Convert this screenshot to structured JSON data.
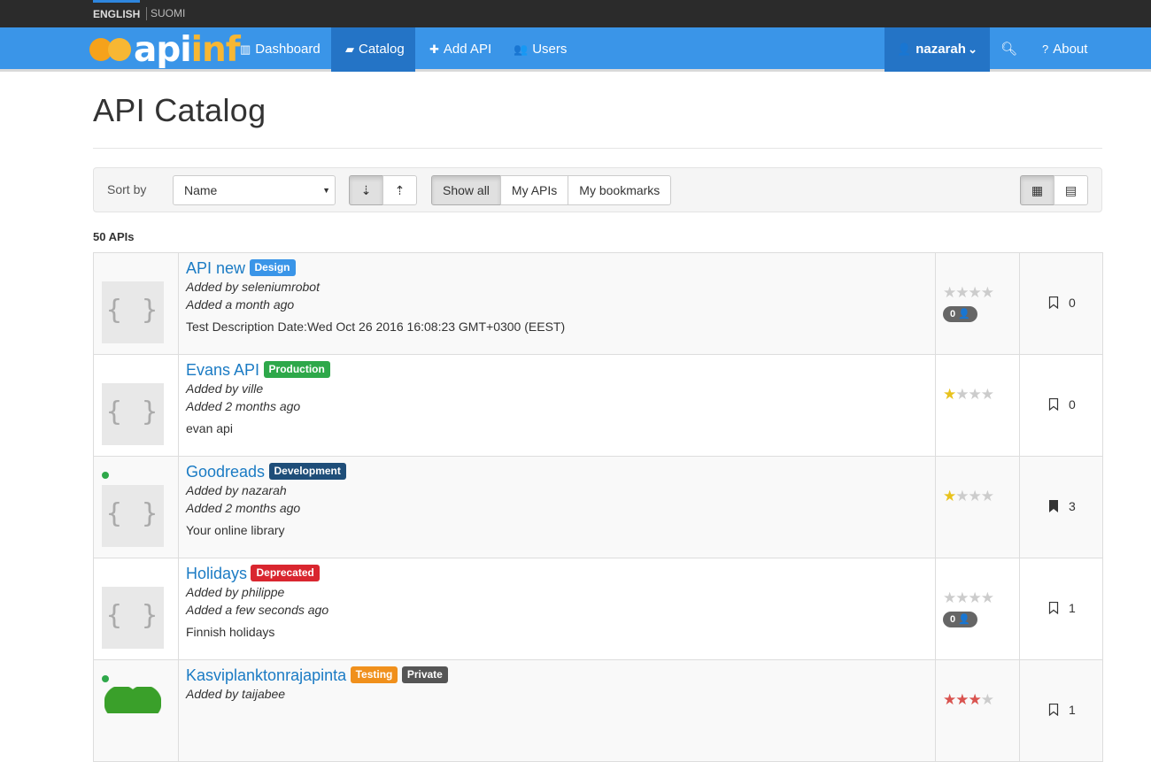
{
  "languages": [
    {
      "label": "ENGLISH"
    },
    {
      "label": "SUOMI"
    }
  ],
  "brand": {
    "api": "api",
    "inf": "inf"
  },
  "nav": {
    "dashboard": "Dashboard",
    "catalog": "Catalog",
    "add_api": "Add API",
    "users": "Users",
    "user": "nazarah",
    "about": "About"
  },
  "page": {
    "title": "API Catalog",
    "count": "50 APIs"
  },
  "filters": {
    "sort_label": "Sort by",
    "sort_value": "Name",
    "show_all": "Show all",
    "my_apis": "My APIs",
    "my_bookmarks": "My bookmarks"
  },
  "colors": {
    "development": "#1f4e79",
    "testing": "#f0901c",
    "production": "#2ea84a",
    "design": "#3a95e8",
    "deprecated": "#d9262f",
    "private": "#555555"
  },
  "apis": [
    {
      "name": "API new",
      "badge": "Design",
      "added_by": "Added by seleniumrobot",
      "added_when": "Added a month ago",
      "description": "Test Description Date:Wed Oct 26 2016 16:08:23 GMT+0300 (EEST)",
      "rating": 0,
      "user_ratings": "0",
      "bookmarks": "0"
    },
    {
      "name": "Evans API",
      "badge": "Production",
      "added_by": "Added by ville",
      "added_when": "Added 2 months ago",
      "description": "evan api",
      "rating": 1,
      "bookmarks": "0"
    },
    {
      "name": "Goodreads",
      "badge": "Development",
      "added_by": "Added by nazarah",
      "added_when": "Added 2 months ago",
      "description": "Your online library",
      "rating": 1,
      "bookmarks": "3"
    },
    {
      "name": "Holidays",
      "badge": "Deprecated",
      "added_by": "Added by philippe",
      "added_when": "Added a few seconds ago",
      "description": "Finnish holidays",
      "rating": 0,
      "user_ratings": "0",
      "bookmarks": "1"
    },
    {
      "name": "Kasviplanktonrajapinta",
      "badge": "Testing",
      "badge2": "Private",
      "added_by": "Added by taijabee",
      "rating": 3,
      "bookmarks": "1"
    }
  ]
}
